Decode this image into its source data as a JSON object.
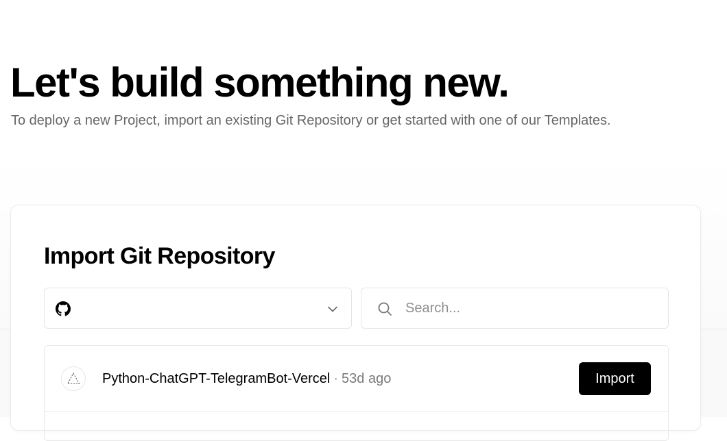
{
  "header": {
    "title": "Let's build something new.",
    "subtitle": "To deploy a new Project, import an existing Git Repository or get started with one of our Templates."
  },
  "import_card": {
    "title": "Import Git Repository",
    "scope_selector": {
      "icon": "github-icon",
      "selected_value": "",
      "dropdown_icon": "chevron-down-icon"
    },
    "search": {
      "icon": "search-icon",
      "placeholder": "Search...",
      "value": ""
    },
    "repositories": [
      {
        "icon": "vercel-triangle-icon",
        "name": "Python-ChatGPT-TelegramBot-Vercel",
        "separator": "·",
        "age": "53d ago",
        "action_label": "Import"
      }
    ]
  },
  "colors": {
    "primary_button_bg": "#000000",
    "primary_button_text": "#ffffff",
    "muted_text": "#666666",
    "border": "#e5e5e5"
  }
}
